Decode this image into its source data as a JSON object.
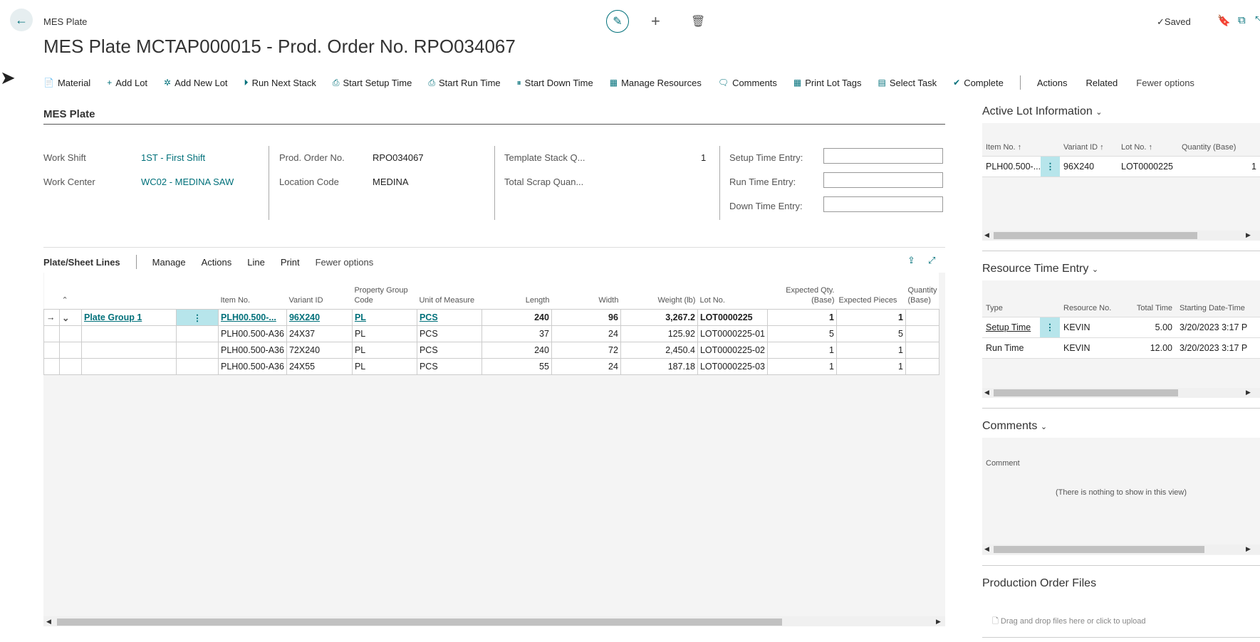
{
  "header": {
    "breadcrumb": "MES Plate",
    "title": "MES Plate MCTAP000015 - Prod. Order No. RPO034067",
    "saved": "✓Saved"
  },
  "actions": [
    {
      "label": "Material",
      "icon": "📄"
    },
    {
      "label": "Add Lot",
      "icon": "+"
    },
    {
      "label": "Add New Lot",
      "icon": "✲"
    },
    {
      "label": "Run Next Stack",
      "icon": "⏵"
    },
    {
      "label": "Start Setup Time",
      "icon": "⎙"
    },
    {
      "label": "Start Run Time",
      "icon": "⎙"
    },
    {
      "label": "Start Down Time",
      "icon": "⏸"
    },
    {
      "label": "Manage Resources",
      "icon": "▦"
    },
    {
      "label": "Comments",
      "icon": "🗨"
    },
    {
      "label": "Print Lot Tags",
      "icon": "▦"
    },
    {
      "label": "Select Task",
      "icon": "▤"
    },
    {
      "label": "Complete",
      "icon": "✔"
    }
  ],
  "action_menus": {
    "actions": "Actions",
    "related": "Related",
    "fewer": "Fewer options"
  },
  "general": {
    "section_title": "MES Plate",
    "work_shift_label": "Work Shift",
    "work_shift": "1ST - First Shift",
    "work_center_label": "Work Center",
    "work_center": "WC02 - MEDINA SAW",
    "prod_order_label": "Prod. Order No.",
    "prod_order": "RPO034067",
    "location_label": "Location Code",
    "location": "MEDINA",
    "template_stack_label": "Template Stack Q...",
    "template_stack": "1",
    "total_scrap_label": "Total Scrap Quan...",
    "setup_time_label": "Setup Time Entry:",
    "run_time_label": "Run Time Entry:",
    "down_time_label": "Down Time Entry:"
  },
  "lines": {
    "title": "Plate/Sheet Lines",
    "menu": [
      "Manage",
      "Actions",
      "Line",
      "Print",
      "Fewer options"
    ],
    "columns": [
      "Item No.",
      "Variant ID",
      "Property Group Code",
      "Unit of Measure",
      "Length",
      "Width",
      "Weight (lb)",
      "Lot No.",
      "Expected Qty. (Base)",
      "Expected Pieces",
      "Quantity (Base)"
    ],
    "group_label": "Plate Group 1",
    "rows": [
      {
        "item": "PLH00.500-...",
        "variant": "96X240",
        "pg": "PL",
        "uom": "PCS",
        "length": "240",
        "width": "96",
        "weight": "3,267.2",
        "lot": "LOT0000225",
        "exp_qty": "1",
        "exp_pcs": "1",
        "qty": ""
      },
      {
        "item": "PLH00.500-A36",
        "variant": "24X37",
        "pg": "PL",
        "uom": "PCS",
        "length": "37",
        "width": "24",
        "weight": "125.92",
        "lot": "LOT0000225-01",
        "exp_qty": "5",
        "exp_pcs": "5",
        "qty": ""
      },
      {
        "item": "PLH00.500-A36",
        "variant": "72X240",
        "pg": "PL",
        "uom": "PCS",
        "length": "240",
        "width": "72",
        "weight": "2,450.4",
        "lot": "LOT0000225-02",
        "exp_qty": "1",
        "exp_pcs": "1",
        "qty": ""
      },
      {
        "item": "PLH00.500-A36",
        "variant": "24X55",
        "pg": "PL",
        "uom": "PCS",
        "length": "55",
        "width": "24",
        "weight": "187.18",
        "lot": "LOT0000225-03",
        "exp_qty": "1",
        "exp_pcs": "1",
        "qty": ""
      }
    ]
  },
  "active_lot": {
    "title": "Active Lot Information",
    "columns": [
      "Item No. ↑",
      "Variant ID ↑",
      "Lot No. ↑",
      "Quantity (Base)"
    ],
    "rows": [
      {
        "item": "PLH00.500-...",
        "variant": "96X240",
        "lot": "LOT0000225",
        "qty": "1"
      }
    ]
  },
  "resource_time": {
    "title": "Resource Time Entry",
    "columns": [
      "Type",
      "Resource No.",
      "Total Time",
      "Starting Date-Time"
    ],
    "rows": [
      {
        "type": "Setup Time",
        "resource": "KEVIN",
        "total": "5.00",
        "start": "3/20/2023 3:17 P"
      },
      {
        "type": "Run Time",
        "resource": "KEVIN",
        "total": "12.00",
        "start": "3/20/2023 3:17 P"
      }
    ]
  },
  "comments": {
    "title": "Comments",
    "column": "Comment",
    "empty": "(There is nothing to show in this view)"
  },
  "files": {
    "title": "Production Order Files",
    "hint": "Drag and drop files here or click to upload"
  }
}
